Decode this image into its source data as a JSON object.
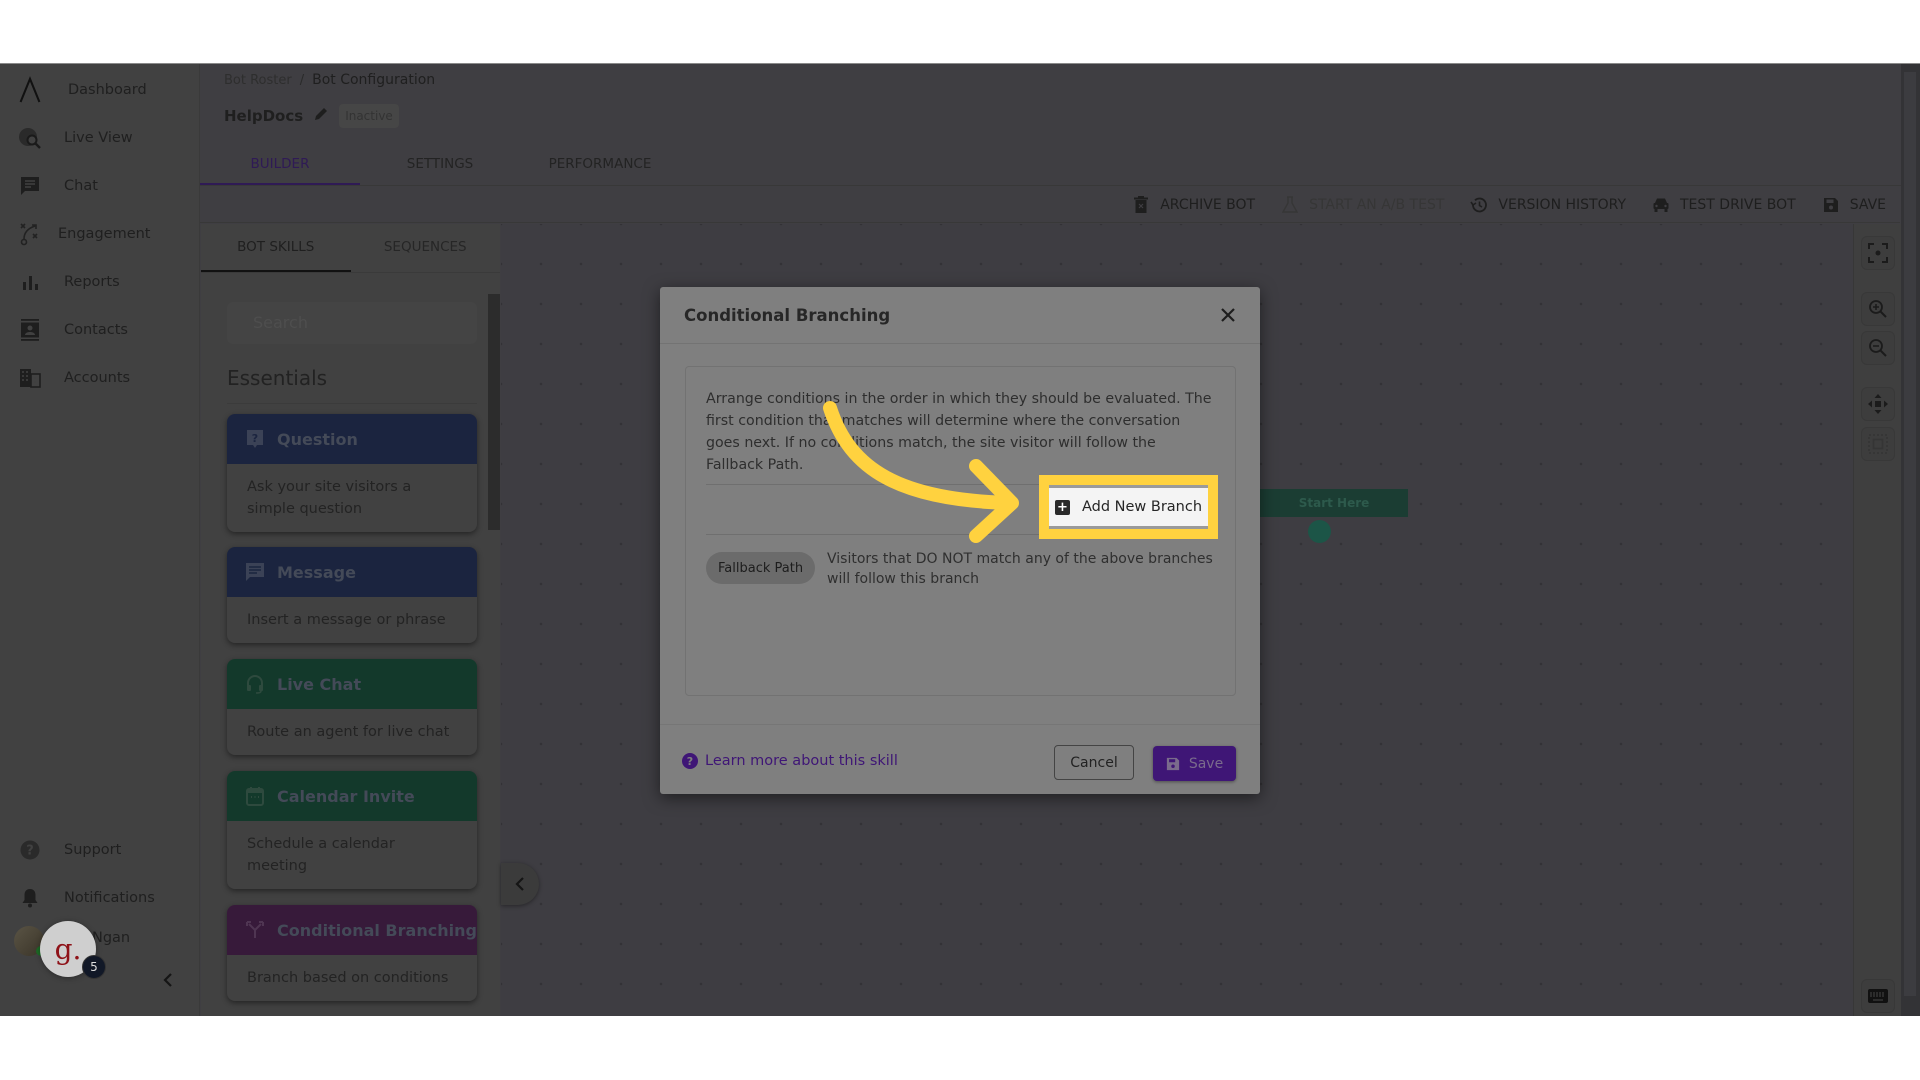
{
  "nav": {
    "items": [
      {
        "label": "Dashboard",
        "icon": "logo-caret-icon"
      },
      {
        "label": "Live View",
        "icon": "globe-search-icon"
      },
      {
        "label": "Chat",
        "icon": "chat-bubble-icon"
      },
      {
        "label": "Engagement",
        "icon": "strategy-icon"
      },
      {
        "label": "Reports",
        "icon": "bar-chart-icon"
      },
      {
        "label": "Contacts",
        "icon": "contact-card-icon"
      },
      {
        "label": "Accounts",
        "icon": "building-icon"
      }
    ],
    "bottom_items": [
      {
        "label": "Support",
        "icon": "help-circle-icon"
      },
      {
        "label": "Notifications",
        "icon": "bell-icon"
      }
    ],
    "user_name": "Ngan",
    "widget_letter": "g.",
    "widget_badge_count": "5"
  },
  "header": {
    "breadcrumb": [
      "Bot Roster",
      "Bot Configuration"
    ],
    "breadcrumb_separator": "/",
    "bot_name": "HelpDocs",
    "status": "Inactive",
    "tabs": [
      {
        "label": "BUILDER",
        "active": true
      },
      {
        "label": "SETTINGS",
        "active": false
      },
      {
        "label": "PERFORMANCE",
        "active": false
      }
    ]
  },
  "toolbar": {
    "archive": "ARCHIVE BOT",
    "ab_test": "START AN A/B TEST",
    "version_history": "VERSION HISTORY",
    "test_drive": "TEST DRIVE BOT",
    "save": "SAVE"
  },
  "skills_panel": {
    "tabs": [
      {
        "label": "BOT SKILLS",
        "active": true
      },
      {
        "label": "SEQUENCES",
        "active": false
      }
    ],
    "search_placeholder": "Search",
    "section_title": "Essentials",
    "cards": [
      {
        "title": "Question",
        "desc": "Ask your site visitors a simple question",
        "color": "#1b243f"
      },
      {
        "title": "Message",
        "desc": "Insert a message or phrase",
        "color": "#1b243f"
      },
      {
        "title": "Live Chat",
        "desc": "Route an agent for live chat",
        "color": "#13392b"
      },
      {
        "title": "Calendar Invite",
        "desc": "Schedule a calendar meeting",
        "color": "#13392b"
      },
      {
        "title": "Conditional Branching",
        "desc": "Branch based on conditions",
        "color": "#371a3a"
      }
    ]
  },
  "canvas": {
    "start_node_label": "Start Here"
  },
  "modal": {
    "title": "Conditional Branching",
    "intro": "Arrange conditions in the order in which they should be evaluated. The first condition that matches will determine where the conversation goes next. If no conditions match, the site visitor will follow the Fallback Path.",
    "add_branch_label": "Add New Branch",
    "fallback_label": "Fallback Path",
    "fallback_desc": "Visitors that DO NOT match any of the above branches will follow this branch",
    "learn_more": "Learn more about this skill",
    "cancel": "Cancel",
    "save": "Save"
  },
  "colors": {
    "accent_purple": "#3f1676",
    "highlight_yellow": "#ffd23f"
  }
}
